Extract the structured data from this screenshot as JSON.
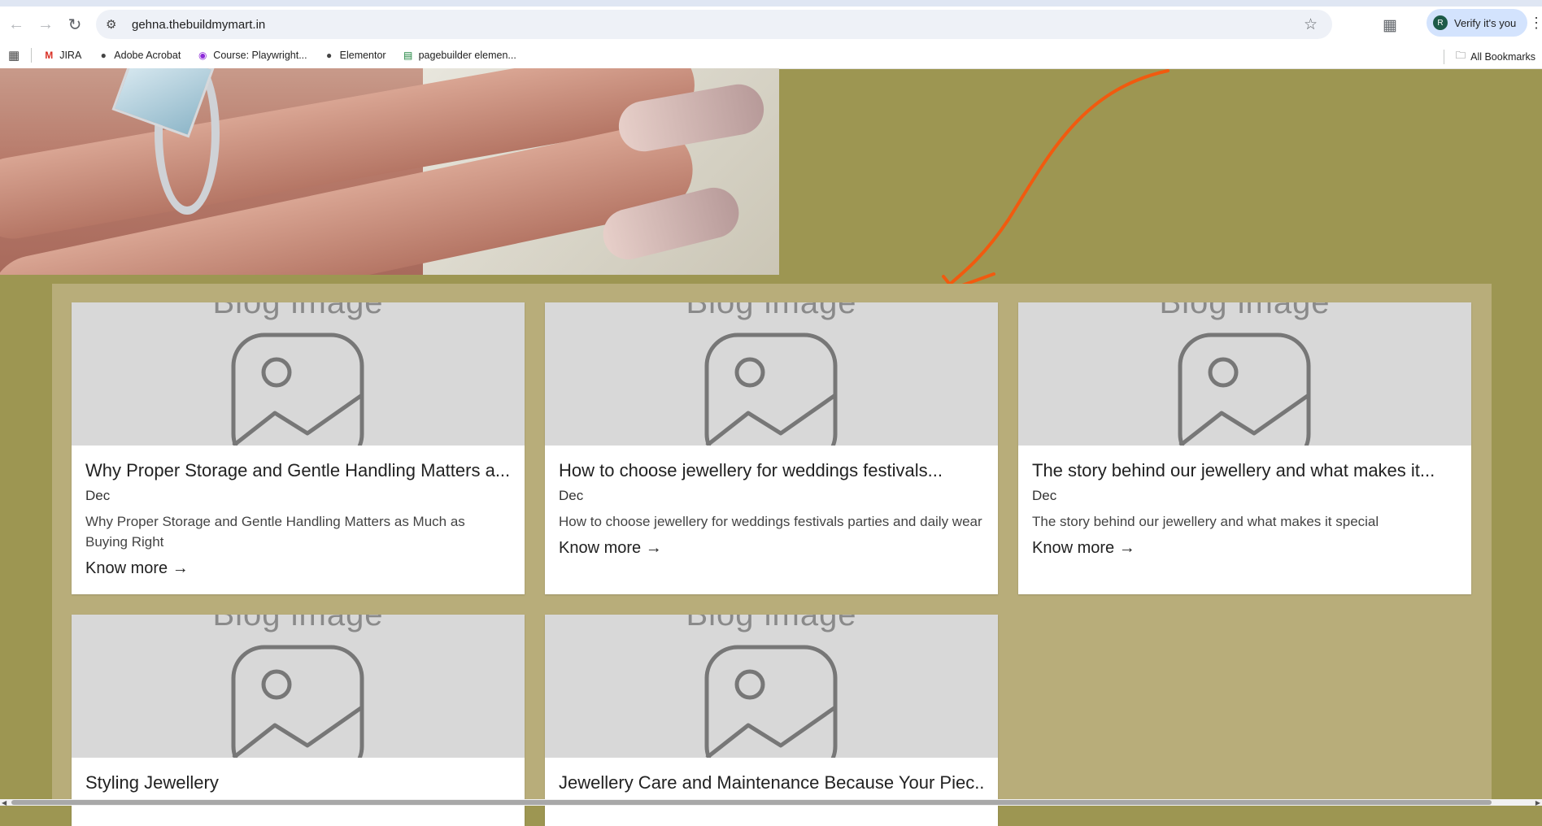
{
  "browser": {
    "url": "gehna.thebuildmymart.in",
    "verify_label": "Verify it's you",
    "avatar_letter": "R",
    "bookmarks": [
      {
        "label": "JIRA",
        "icon": "gmail-icon"
      },
      {
        "label": "Adobe Acrobat",
        "icon": "globe-icon"
      },
      {
        "label": "Course: Playwright...",
        "icon": "course-icon"
      },
      {
        "label": "Elementor",
        "icon": "globe-icon"
      },
      {
        "label": "pagebuilder elemen...",
        "icon": "sheets-icon"
      }
    ],
    "all_bookmarks_label": "All Bookmarks"
  },
  "annotation": {
    "color": "#f15a0f"
  },
  "blog": {
    "placeholder_text": "Blog image",
    "more_label": "Know more →",
    "cards": [
      {
        "title": "Why Proper Storage and Gentle Handling Matters a...",
        "date": "Dec",
        "excerpt": "Why Proper Storage and Gentle Handling Matters as Much as Buying Right"
      },
      {
        "title": "How to choose jewellery for weddings festivals...",
        "date": "Dec",
        "excerpt": "How to choose jewellery for weddings festivals parties and daily wear"
      },
      {
        "title": "The story behind our jewellery and what makes it...",
        "date": "Dec",
        "excerpt": "The story behind our jewellery and what makes it special"
      },
      {
        "title": "Styling Jewellery"
      },
      {
        "title": "Jewellery Care and Maintenance Because Your Piec..."
      }
    ]
  },
  "colors": {
    "page_bg": "#9d9652",
    "panel_bg": "#b8ad7a",
    "card_bg": "#ffffff",
    "placeholder_bg": "#d8d8d8"
  }
}
